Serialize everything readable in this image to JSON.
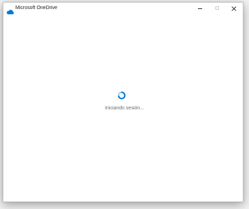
{
  "window": {
    "title": "Microsoft OneDrive",
    "icon": "onedrive-cloud-icon",
    "controls": {
      "minimize": "minimize-icon",
      "maximize": "maximize-icon",
      "close": "close-icon"
    }
  },
  "main": {
    "status": "Iniciando sesión..."
  },
  "colors": {
    "accent": "#0078d4",
    "spinner_light": "#9fd0f5",
    "text_secondary": "#6b6b6b"
  }
}
